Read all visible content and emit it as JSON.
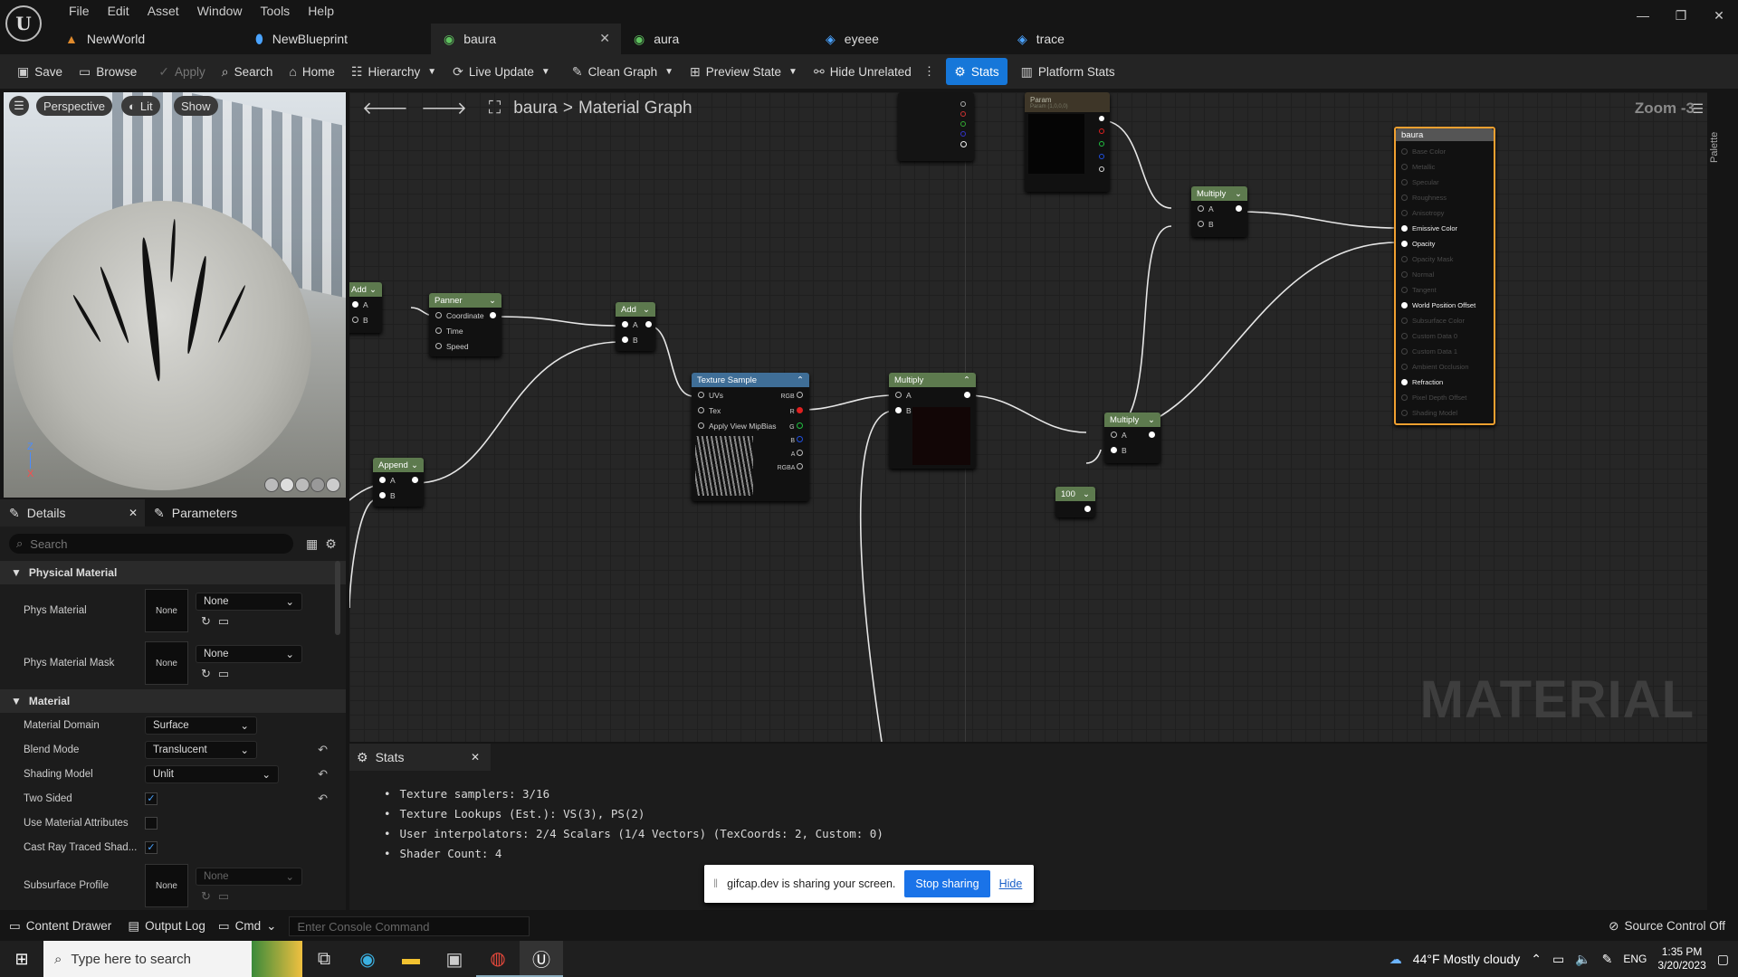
{
  "titlebar": {
    "menus": [
      "File",
      "Edit",
      "Asset",
      "Window",
      "Tools",
      "Help"
    ],
    "tabs": [
      {
        "label": "NewWorld",
        "active": false
      },
      {
        "label": "NewBlueprint",
        "active": false
      },
      {
        "label": "baura",
        "active": true
      },
      {
        "label": "aura",
        "active": false
      },
      {
        "label": "eyeee",
        "active": false
      },
      {
        "label": "trace",
        "active": false
      }
    ]
  },
  "toolbar": {
    "save": "Save",
    "browse": "Browse",
    "apply": "Apply",
    "search": "Search",
    "home": "Home",
    "hierarchy": "Hierarchy",
    "live_update": "Live Update",
    "clean_graph": "Clean Graph",
    "preview_state": "Preview State",
    "hide_unrelated": "Hide Unrelated",
    "stats": "Stats",
    "platform_stats": "Platform Stats"
  },
  "viewport": {
    "perspective": "Perspective",
    "lit": "Lit",
    "show": "Show",
    "axis_z": "Z",
    "axis_x": "X"
  },
  "details": {
    "tab_details": "Details",
    "tab_parameters": "Parameters",
    "search_placeholder": "Search",
    "section_physical": "Physical Material",
    "phys_material": {
      "label": "Phys Material",
      "thumb": "None",
      "value": "None"
    },
    "phys_material_mask": {
      "label": "Phys Material Mask",
      "thumb": "None",
      "value": "None"
    },
    "section_material": "Material",
    "material_domain": {
      "label": "Material Domain",
      "value": "Surface"
    },
    "blend_mode": {
      "label": "Blend Mode",
      "value": "Translucent"
    },
    "shading_model": {
      "label": "Shading Model",
      "value": "Unlit"
    },
    "two_sided": {
      "label": "Two Sided",
      "checked": true
    },
    "use_material_attributes": {
      "label": "Use Material Attributes",
      "checked": false
    },
    "cast_ray_traced": {
      "label": "Cast Ray Traced Shad...",
      "checked": true
    },
    "subsurface_profile": {
      "label": "Subsurface Profile",
      "thumb": "None",
      "value": "None"
    }
  },
  "graph": {
    "breadcrumb_asset": "baura",
    "breadcrumb_sep": ">",
    "breadcrumb_graph": "Material Graph",
    "zoom": "Zoom -3",
    "watermark": "MATERIAL",
    "palette": "Palette",
    "nodes": {
      "add_left": {
        "title": "Add",
        "pins": [
          "A",
          "B"
        ]
      },
      "panner": {
        "title": "Panner",
        "pins": [
          "Coordinate",
          "Time",
          "Speed"
        ]
      },
      "add_mid": {
        "title": "Add",
        "pins": [
          "A",
          "B"
        ]
      },
      "append": {
        "title": "Append",
        "pins": [
          "A",
          "B"
        ]
      },
      "texture_sample": {
        "title": "Texture Sample",
        "pins_in": [
          "UVs",
          "Tex",
          "Apply View MipBias"
        ],
        "pins_out": [
          "RGB",
          "R",
          "G",
          "B",
          "A",
          "RGBA"
        ]
      },
      "multiply_mid": {
        "title": "Multiply",
        "pins": [
          "A",
          "B"
        ]
      },
      "multiply_right": {
        "title": "Multiply",
        "pins": [
          "A",
          "B"
        ]
      },
      "multiply_top": {
        "title": "Multiply",
        "pins": [
          "A",
          "B"
        ]
      },
      "const_100": {
        "title": "100"
      },
      "param": {
        "title": "Param",
        "subtitle": "Param (1,0,0,0)"
      },
      "result": {
        "title": "baura",
        "pins": [
          {
            "label": "Base Color",
            "active": false
          },
          {
            "label": "Metallic",
            "active": false
          },
          {
            "label": "Specular",
            "active": false
          },
          {
            "label": "Roughness",
            "active": false
          },
          {
            "label": "Anisotropy",
            "active": false
          },
          {
            "label": "Emissive Color",
            "active": true
          },
          {
            "label": "Opacity",
            "active": true
          },
          {
            "label": "Opacity Mask",
            "active": false
          },
          {
            "label": "Normal",
            "active": false
          },
          {
            "label": "Tangent",
            "active": false
          },
          {
            "label": "World Position Offset",
            "active": true
          },
          {
            "label": "Subsurface Color",
            "active": false
          },
          {
            "label": "Custom Data 0",
            "active": false
          },
          {
            "label": "Custom Data 1",
            "active": false
          },
          {
            "label": "Ambient Occlusion",
            "active": false
          },
          {
            "label": "Refraction",
            "active": true
          },
          {
            "label": "Pixel Depth Offset",
            "active": false
          },
          {
            "label": "Shading Model",
            "active": false
          }
        ]
      }
    }
  },
  "stats": {
    "tab": "Stats",
    "lines": [
      "Texture samplers: 3/16",
      "Texture Lookups (Est.): VS(3), PS(2)",
      "User interpolators: 2/4 Scalars (1/4 Vectors) (TexCoords: 2, Custom: 0)",
      "Shader Count: 4"
    ]
  },
  "share_bar": {
    "text": "gifcap.dev is sharing your screen.",
    "stop": "Stop sharing",
    "hide": "Hide"
  },
  "statusbar": {
    "content_drawer": "Content Drawer",
    "output_log": "Output Log",
    "cmd": "Cmd",
    "console_placeholder": "Enter Console Command",
    "source_control": "Source Control Off"
  },
  "taskbar": {
    "search_placeholder": "Type here to search",
    "weather": "44°F  Mostly cloudy",
    "lang": "ENG",
    "time": "1:35 PM",
    "date": "3/20/2023"
  },
  "colors": {
    "accent": "#1677d9",
    "node_selected": "#f0a030",
    "pin_red": "#e02020",
    "pin_green": "#20c040",
    "pin_blue": "#2050e0"
  }
}
